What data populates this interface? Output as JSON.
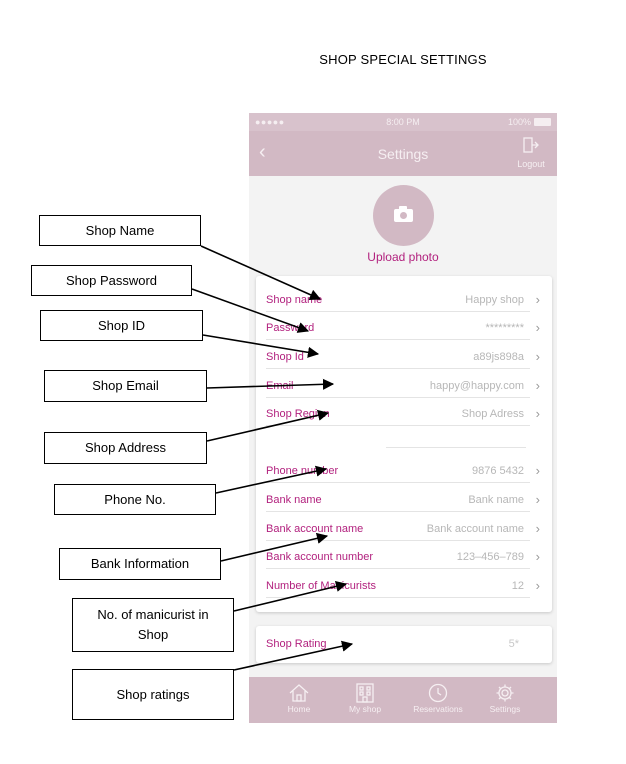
{
  "doc": {
    "title": "SHOP SPECIAL SETTINGS"
  },
  "status_bar": {
    "signal": "●●●●● ",
    "time": "8:00 PM",
    "battery": "100%"
  },
  "nav": {
    "back": "‹",
    "title": "Settings",
    "logout": "Logout",
    "logout_icon": "logout-door-icon"
  },
  "avatar": {
    "icon": "camera-icon",
    "upload_label": "Upload photo"
  },
  "rows": [
    {
      "label": "Shop name",
      "value": "Happy shop"
    },
    {
      "label": "Password",
      "value": "*********"
    },
    {
      "label": "Shop Id",
      "value": "a89js898a"
    },
    {
      "label": "Email",
      "value": "happy@happy.com"
    },
    {
      "label": "Shop Region",
      "value": "Shop Adress"
    },
    {
      "label": "Phone number",
      "value": "9876 5432"
    },
    {
      "label": "Bank name",
      "value": "Bank name"
    },
    {
      "label": "Bank account name",
      "value": "Bank account name"
    },
    {
      "label": "Bank account number",
      "value": "123–456–789"
    },
    {
      "label": "Number of Manicurists",
      "value": "12"
    }
  ],
  "chevron": "›",
  "rating": {
    "label": "Shop Rating",
    "value": "5*"
  },
  "tabs": [
    {
      "label": "Home",
      "icon": "home-icon"
    },
    {
      "label": "My shop",
      "icon": "shop-icon"
    },
    {
      "label": "Reservations",
      "icon": "clock-icon"
    },
    {
      "label": "Settings",
      "icon": "gear-icon"
    }
  ],
  "callouts": [
    "Shop Name",
    "Shop Password",
    "Shop ID",
    "Shop Email",
    "Shop Address",
    "Phone No.",
    "Bank Information",
    "No. of manicurist in Shop",
    "Shop ratings"
  ],
  "colors": {
    "accent": "#b2217e",
    "bar": "#d2b9c4",
    "value": "#b7b7b7",
    "background": "#f3f3f3"
  }
}
